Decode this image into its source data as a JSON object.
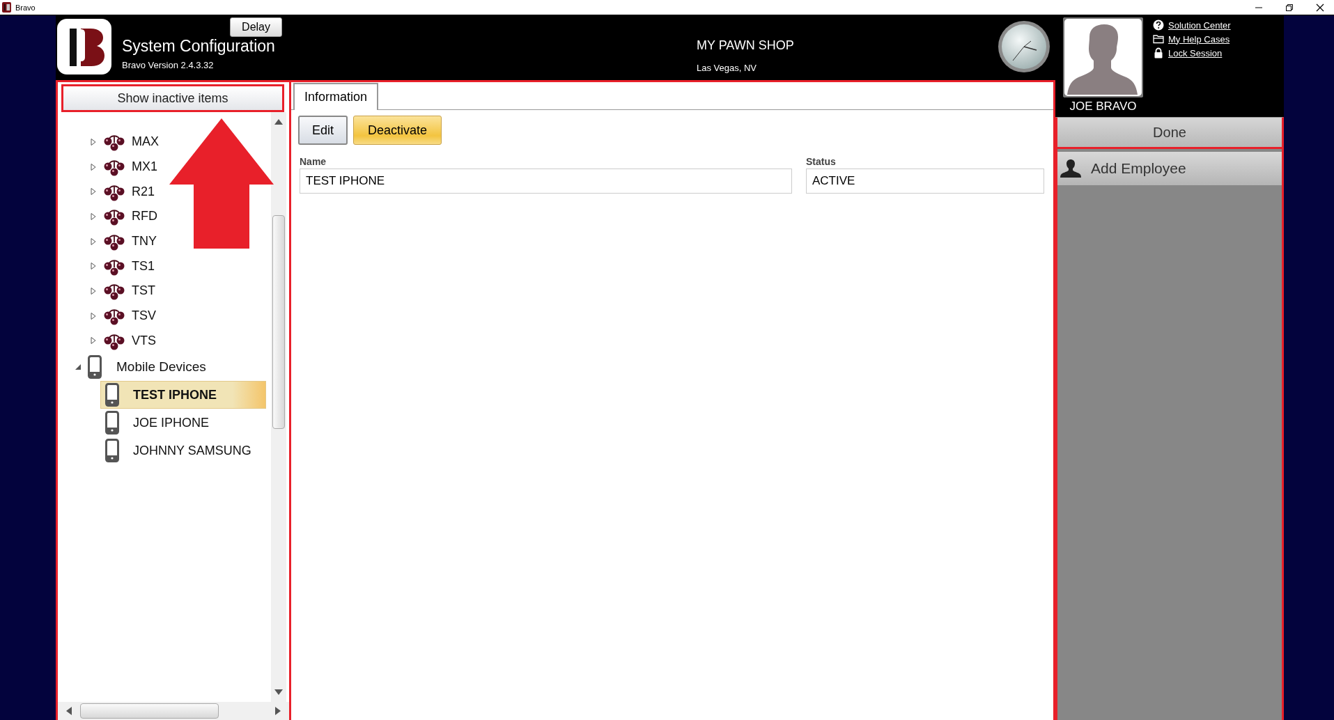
{
  "window": {
    "title": "Bravo"
  },
  "header": {
    "delay_button": "Delay",
    "app_title": "System Configuration",
    "version": "Bravo Version 2.4.3.32",
    "shop_name": "MY PAWN SHOP",
    "shop_location": "Las Vegas, NV"
  },
  "user": {
    "name": "JOE BRAVO",
    "links": [
      {
        "label": "Solution Center",
        "kind": "help"
      },
      {
        "label": "My Help Cases",
        "kind": "folder"
      },
      {
        "label": "Lock Session",
        "kind": "lock"
      }
    ]
  },
  "sidebar": {
    "toggle_button": "Show inactive items",
    "tree": [
      {
        "label": "MAX",
        "kind": "store",
        "expanded": false
      },
      {
        "label": "MX1",
        "kind": "store",
        "expanded": false
      },
      {
        "label": "R21",
        "kind": "store",
        "expanded": false
      },
      {
        "label": "RFD",
        "kind": "store",
        "expanded": false
      },
      {
        "label": "TNY",
        "kind": "store",
        "expanded": false
      },
      {
        "label": "TS1",
        "kind": "store",
        "expanded": false
      },
      {
        "label": "TST",
        "kind": "store",
        "expanded": false
      },
      {
        "label": "TSV",
        "kind": "store",
        "expanded": false
      },
      {
        "label": "VTS",
        "kind": "store",
        "expanded": false
      },
      {
        "label": "Mobile Devices",
        "kind": "group",
        "expanded": true,
        "children": [
          {
            "label": "TEST IPHONE",
            "kind": "device",
            "selected": true
          },
          {
            "label": "JOE IPHONE",
            "kind": "device",
            "selected": false
          },
          {
            "label": "JOHNNY SAMSUNG",
            "kind": "device",
            "selected": false
          }
        ]
      }
    ]
  },
  "tabs": [
    {
      "label": "Information",
      "selected": true
    }
  ],
  "actions": [
    {
      "label": "Edit",
      "kind": "plain"
    },
    {
      "label": "Deactivate",
      "kind": "warning"
    }
  ],
  "fields": [
    {
      "label": "Name",
      "value": "TEST IPHONE"
    },
    {
      "label": "Status",
      "value": "ACTIVE"
    }
  ],
  "side_panel": {
    "done_button": "Done",
    "actions": [
      {
        "label": "Add Employee",
        "kind": "person"
      }
    ]
  }
}
